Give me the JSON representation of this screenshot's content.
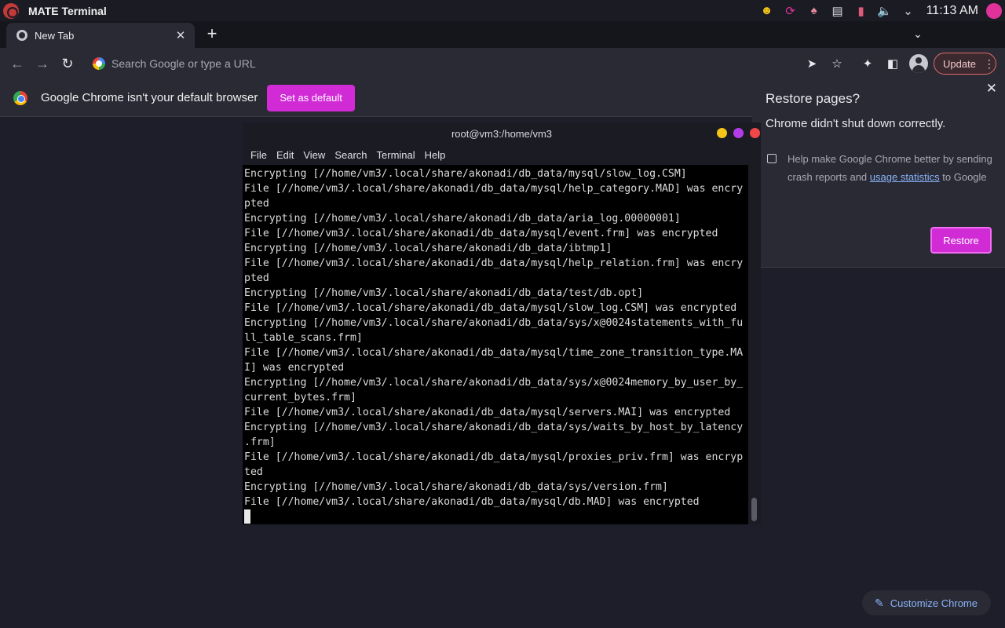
{
  "system": {
    "app_title": "MATE Terminal",
    "clock": "11:13 AM",
    "tray_icons": [
      "user-icon",
      "sync-icon",
      "person-icon",
      "clipboard-icon",
      "mic-icon",
      "volume-icon",
      "chevron-down-icon",
      "power-icon"
    ]
  },
  "browser": {
    "tab_title": "New Tab",
    "omnibox_placeholder": "Search Google or type a URL",
    "update_label": "Update",
    "infobar": {
      "message": "Google Chrome isn't your default browser",
      "button": "Set as default"
    },
    "restore": {
      "title": "Restore pages?",
      "subtitle": "Chrome didn't shut down correctly.",
      "help_pre": "Help make Google Chrome better by sending crash reports and ",
      "help_link": "usage statistics",
      "help_post": " to Google",
      "button": "Restore",
      "checkbox_checked": false
    },
    "customize_label": "Customize Chrome"
  },
  "terminal": {
    "title": "root@vm3:/home/vm3",
    "menu": [
      "File",
      "Edit",
      "View",
      "Search",
      "Terminal",
      "Help"
    ],
    "lines": [
      "Encrypting [//home/vm3/.local/share/akonadi/db_data/mysql/slow_log.CSM]",
      "File [//home/vm3/.local/share/akonadi/db_data/mysql/help_category.MAD] was encry",
      "pted",
      "Encrypting [//home/vm3/.local/share/akonadi/db_data/aria_log.00000001]",
      "File [//home/vm3/.local/share/akonadi/db_data/mysql/event.frm] was encrypted",
      "Encrypting [//home/vm3/.local/share/akonadi/db_data/ibtmp1]",
      "File [//home/vm3/.local/share/akonadi/db_data/mysql/help_relation.frm] was encry",
      "pted",
      "Encrypting [//home/vm3/.local/share/akonadi/db_data/test/db.opt]",
      "File [//home/vm3/.local/share/akonadi/db_data/mysql/slow_log.CSM] was encrypted",
      "Encrypting [//home/vm3/.local/share/akonadi/db_data/sys/x@0024statements_with_fu",
      "ll_table_scans.frm]",
      "File [//home/vm3/.local/share/akonadi/db_data/mysql/time_zone_transition_type.MA",
      "I] was encrypted",
      "Encrypting [//home/vm3/.local/share/akonadi/db_data/sys/x@0024memory_by_user_by_",
      "current_bytes.frm]",
      "File [//home/vm3/.local/share/akonadi/db_data/mysql/servers.MAI] was encrypted",
      "Encrypting [//home/vm3/.local/share/akonadi/db_data/sys/waits_by_host_by_latency",
      ".frm]",
      "File [//home/vm3/.local/share/akonadi/db_data/mysql/proxies_priv.frm] was encryp",
      "ted",
      "Encrypting [//home/vm3/.local/share/akonadi/db_data/sys/version.frm]",
      "File [//home/vm3/.local/share/akonadi/db_data/mysql/db.MAD] was encrypted"
    ]
  },
  "colors": {
    "accent": "#d12bd6",
    "link": "#8ab4f8",
    "window_btn_minimize": "#f5c518",
    "window_btn_maximize": "#b43ce8",
    "window_btn_close": "#f04848"
  }
}
